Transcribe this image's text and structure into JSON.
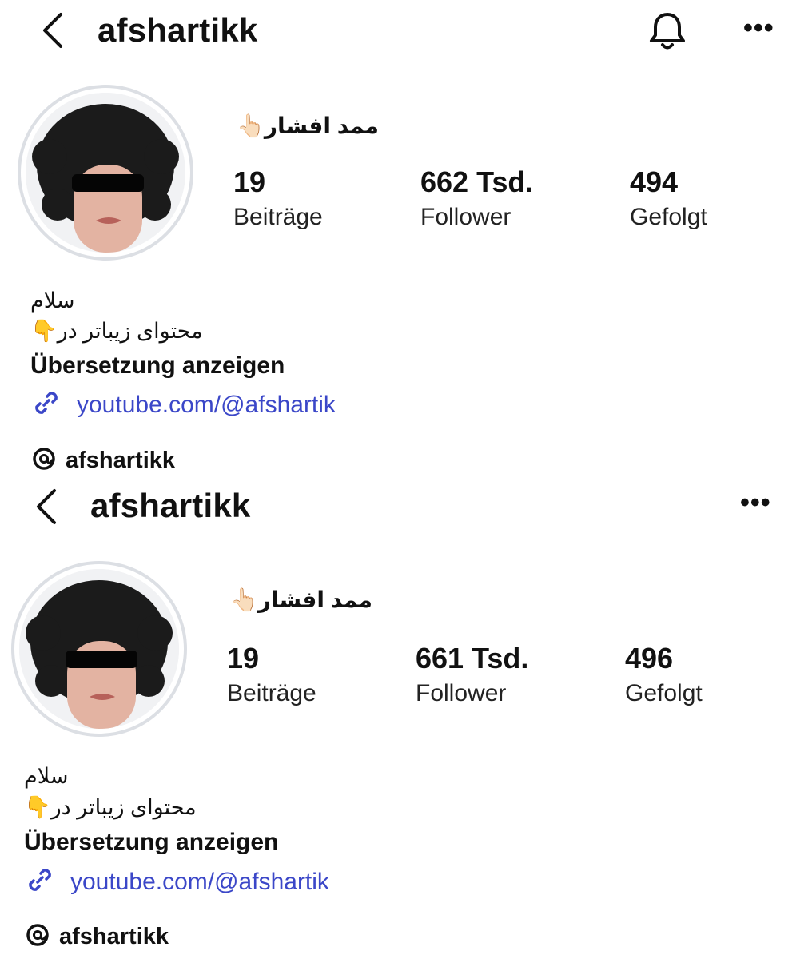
{
  "profiles": [
    {
      "username": "afshartikk",
      "display_name": "ممد افشار👆🏻",
      "stats": [
        {
          "value": "19",
          "label": "Beiträge"
        },
        {
          "value": "662 Tsd.",
          "label": "Follower"
        },
        {
          "value": "494",
          "label": "Gefolgt"
        }
      ],
      "bio": [
        "سلام",
        "محتوای زیباتر در👇"
      ],
      "translate_label": "Übersetzung anzeigen",
      "link": "youtube.com/@afshartik",
      "threads_handle": "afshartikk",
      "icons": [
        "back-icon",
        "bell-icon",
        "more-icon",
        "link-icon",
        "threads-icon"
      ]
    },
    {
      "username": "afshartikk",
      "display_name": "ممد افشار👆🏻",
      "stats": [
        {
          "value": "19",
          "label": "Beiträge"
        },
        {
          "value": "661 Tsd.",
          "label": "Follower"
        },
        {
          "value": "496",
          "label": "Gefolgt"
        }
      ],
      "bio": [
        "سلام",
        "محتوای زیباتر در👇"
      ],
      "translate_label": "Übersetzung anzeigen",
      "link": "youtube.com/@afshartik",
      "threads_handle": "afshartikk",
      "icons": [
        "back-icon",
        "more-icon",
        "link-icon",
        "threads-icon"
      ]
    }
  ],
  "colors": {
    "link": "#3b47c8",
    "ring": "#dcdfe4",
    "text": "#111111"
  }
}
